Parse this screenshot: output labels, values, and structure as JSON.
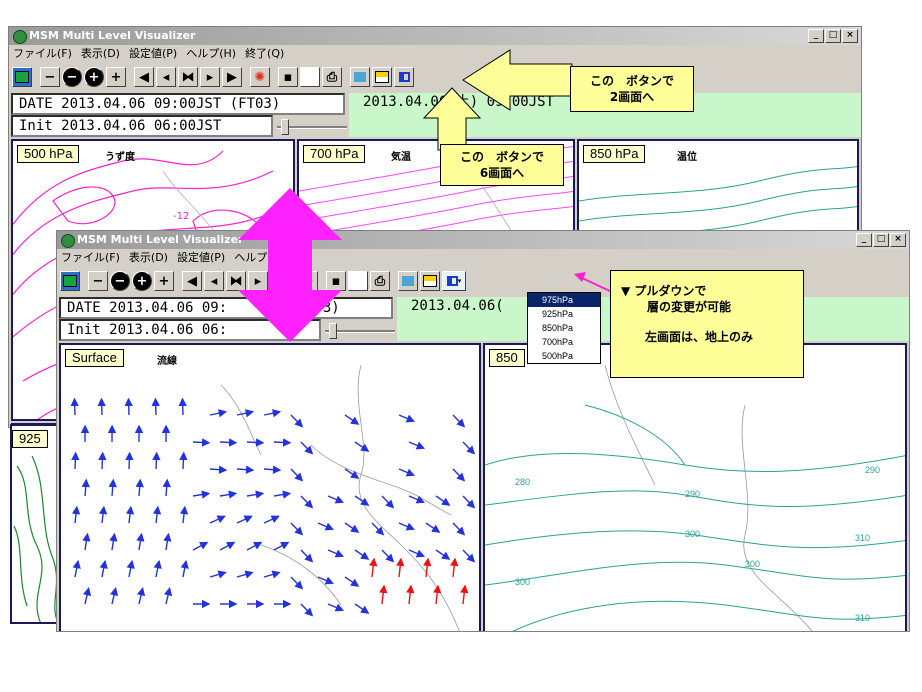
{
  "app": {
    "title": "MSM Multi Level Visualizer",
    "win_buttons": [
      "_",
      "□",
      "×"
    ]
  },
  "menu": [
    "ファイル(F)",
    "表示(D)",
    "設定値(P)",
    "ヘルプ(H)",
    "終了(Q)"
  ],
  "status": {
    "date": "DATE 2013.04.06 09:00JST (FT03)",
    "init": "Init 2013.04.06 06:00JST",
    "valid_back": "2013.04.06(土) 09:00JST",
    "date_front": "DATE 2013.04.06 09:",
    "date_front_tail": "(FT03)",
    "init_front": "Init 2013.04.06 06:",
    "valid_front": "2013.04.06("
  },
  "back_panels": [
    {
      "label": "500 hPa",
      "sub": "うず度"
    },
    {
      "label": "700 hPa",
      "sub": "気温"
    },
    {
      "label": "850 hPa",
      "sub": "温位"
    },
    {
      "label": "925"
    }
  ],
  "front_panels": [
    {
      "label": "Surface",
      "sub": "流線"
    },
    {
      "label": "850"
    }
  ],
  "map_annotation": "-12",
  "contour_labels": [
    "290",
    "290",
    "300",
    "310",
    "280",
    "300",
    "300",
    "310"
  ],
  "dropdown": {
    "options": [
      "975hPa",
      "925hPa",
      "850hPa",
      "700hPa",
      "500hPa"
    ],
    "selected": "975hPa"
  },
  "callouts": {
    "two_screen": [
      "この　ボタンで",
      "2画面へ"
    ],
    "six_screen": [
      "この　ボタンで",
      "6画面へ"
    ],
    "pulldown": [
      "▼ プルダウンで",
      "層の変更が可能",
      "",
      "左画面は、地上のみ"
    ]
  },
  "colors": {
    "vorticity": "#ff22cc",
    "temperature": "#ff44ff",
    "potential_temp": "#2aa198",
    "streamline": "#2233dd",
    "callout_bg": "#ffff99",
    "date_bg": "#c9f7c9"
  }
}
